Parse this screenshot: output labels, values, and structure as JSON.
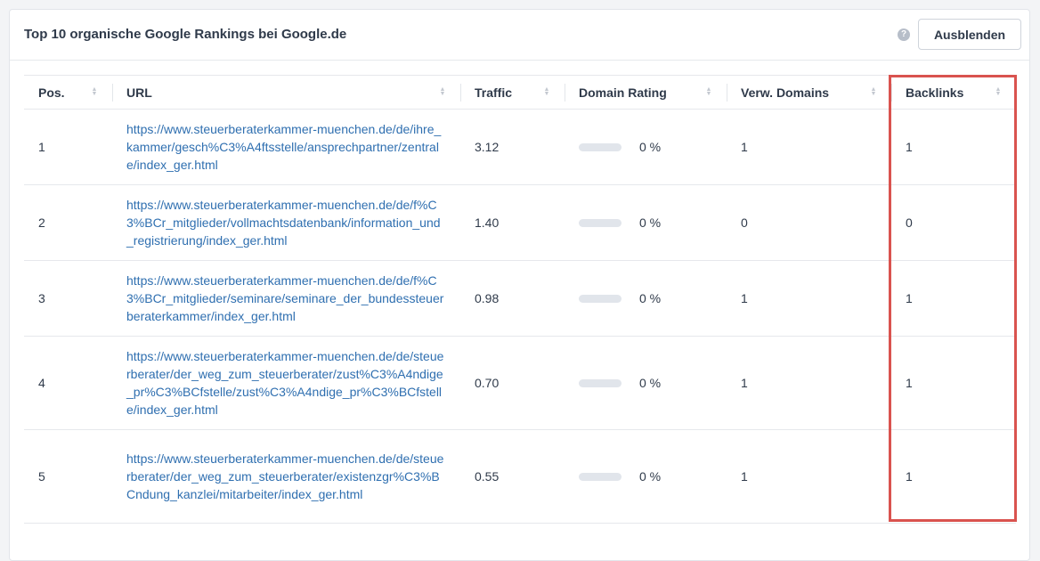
{
  "panel": {
    "title": "Top 10 organische Google Rankings bei Google.de",
    "help_icon": "?",
    "hide_button": "Ausblenden"
  },
  "table": {
    "columns": [
      "Pos.",
      "URL",
      "Traffic",
      "Domain Rating",
      "Verw. Domains",
      "Backlinks"
    ],
    "rows": [
      {
        "pos": "1",
        "url": "https://www.steuerberaterkammer-muenchen.de/de/ihre_kammer/gesch%C3%A4ftsstelle/ansprechpartner/zentrale/index_ger.html",
        "traffic": "3.12",
        "domain_rating": "0 %",
        "domain_rating_fill": 0,
        "ref_domains": "1",
        "backlinks": "1"
      },
      {
        "pos": "2",
        "url": "https://www.steuerberaterkammer-muenchen.de/de/f%C3%BCr_mitglieder/vollmachtsdatenbank/information_und_registrierung/index_ger.html",
        "traffic": "1.40",
        "domain_rating": "0 %",
        "domain_rating_fill": 0,
        "ref_domains": "0",
        "backlinks": "0"
      },
      {
        "pos": "3",
        "url": "https://www.steuerberaterkammer-muenchen.de/de/f%C3%BCr_mitglieder/seminare/seminare_der_bundessteuerberaterkammer/index_ger.html",
        "traffic": "0.98",
        "domain_rating": "0 %",
        "domain_rating_fill": 0,
        "ref_domains": "1",
        "backlinks": "1"
      },
      {
        "pos": "4",
        "url": "https://www.steuerberaterkammer-muenchen.de/de/steuerberater/der_weg_zum_steuerberater/zust%C3%A4ndige_pr%C3%BCfstelle/zust%C3%A4ndige_pr%C3%BCfstelle/index_ger.html",
        "traffic": "0.70",
        "domain_rating": "0 %",
        "domain_rating_fill": 0,
        "ref_domains": "1",
        "backlinks": "1"
      },
      {
        "pos": "5",
        "url": "https://www.steuerberaterkammer-muenchen.de/de/steuerberater/der_weg_zum_steuerberater/existenzgr%C3%BCndung_kanzlei/mitarbeiter/index_ger.html",
        "traffic": "0.55",
        "domain_rating": "0 %",
        "domain_rating_fill": 0,
        "ref_domains": "1",
        "backlinks": "1"
      }
    ]
  },
  "colors": {
    "link": "#2f6fb0",
    "highlight": "#d9534f",
    "bar_track": "#e1e5eb"
  }
}
